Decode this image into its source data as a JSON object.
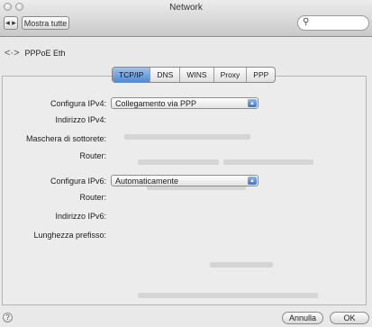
{
  "window": {
    "title": "Network"
  },
  "toolbar": {
    "nav_glyph": "◂ ▸",
    "show_all": "Mostra tutte",
    "search_icon": "search-icon"
  },
  "service": {
    "arrows_glyph": "<·>",
    "name": "PPPoE Eth"
  },
  "tabs": [
    {
      "label": "TCP/IP",
      "active": true
    },
    {
      "label": "DNS"
    },
    {
      "label": "WINS"
    },
    {
      "label": "Proxy"
    },
    {
      "label": "PPP"
    }
  ],
  "ipv4": {
    "configure_label": "Configura IPv4:",
    "configure_value": "Collegamento via PPP",
    "address_label": "Indirizzo IPv4:",
    "subnet_label": "Maschera di sottorete:",
    "router_label": "Router:"
  },
  "ipv6": {
    "configure_label": "Configura IPv6:",
    "configure_value": "Automaticamente",
    "router_label": "Router:",
    "address_label": "Indirizzo IPv6:",
    "prefix_label": "Lunghezza prefisso:"
  },
  "footer": {
    "help": "?",
    "cancel": "Annulla",
    "ok": "OK"
  }
}
